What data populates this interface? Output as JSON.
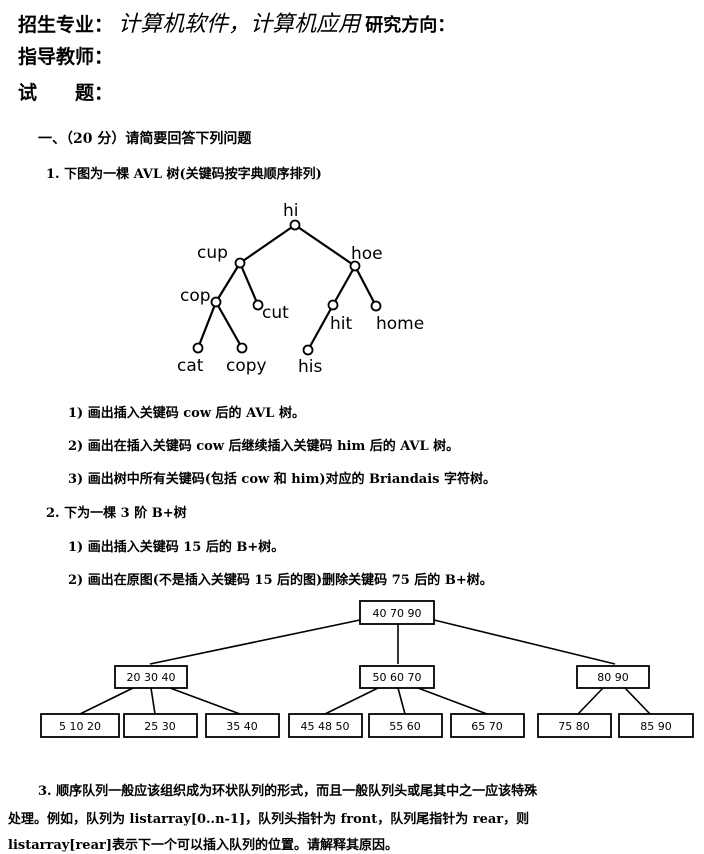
{
  "header": {
    "major_label": "招生专业：",
    "major_value_hand": "计算机软件，计算机应用",
    "major_value_suffix": "研究方向：",
    "advisor_label": "指导教师：",
    "exam_label": "试　　题："
  },
  "section1": {
    "title": "一、（20 分）请简要回答下列问题",
    "q1": {
      "title": "1. 下图为一棵 AVL 树(关键码按字典顺序排列)",
      "tree": {
        "root": "hi",
        "nodes": [
          "hi",
          "cup",
          "hoe",
          "cop",
          "cut",
          "hit",
          "home",
          "cat",
          "copy",
          "his"
        ],
        "edges": [
          [
            "hi",
            "cup"
          ],
          [
            "hi",
            "hoe"
          ],
          [
            "cup",
            "cop"
          ],
          [
            "cup",
            "cut"
          ],
          [
            "hoe",
            "hit"
          ],
          [
            "hoe",
            "home"
          ],
          [
            "cop",
            "cat"
          ],
          [
            "cop",
            "copy"
          ],
          [
            "hit",
            "his"
          ]
        ]
      },
      "subquestions": [
        "1)  画出插入关键码 cow 后的 AVL 树。",
        "2)  画出在插入关键码 cow 后继续插入关键码 him 后的 AVL 树。",
        "3)  画出树中所有关键码(包括 cow 和 him)对应的 Briandais 字符树。"
      ]
    },
    "q2": {
      "title": "2. 下为一棵 3 阶 B+树",
      "subquestions": [
        "1)  画出插入关键码 15 后的 B+树。",
        "2)  画出在原图(不是插入关键码 15 后的图)删除关键码 75 后的 B+树。"
      ],
      "bplus_tree": {
        "root": "40  70  90",
        "internal": [
          "20  30  40",
          "50  60  70",
          "80  90"
        ],
        "leaves": [
          "5  10  20",
          "25  30",
          "35  40",
          "45  48  50",
          "55  60",
          "65  70",
          "75  80",
          "85  90"
        ]
      }
    },
    "q3": {
      "line1": "3. 顺序队列一般应该组织成为环状队列的形式，而且一般队列头或尾其中之一应该特殊",
      "line2": "处理。例如，队列为 listarray[0..n-1]，队列头指针为 front，队列尾指针为 rear，则",
      "line3": "listarray[rear]表示下一个可以插入队列的位置。请解释其原因。"
    }
  }
}
